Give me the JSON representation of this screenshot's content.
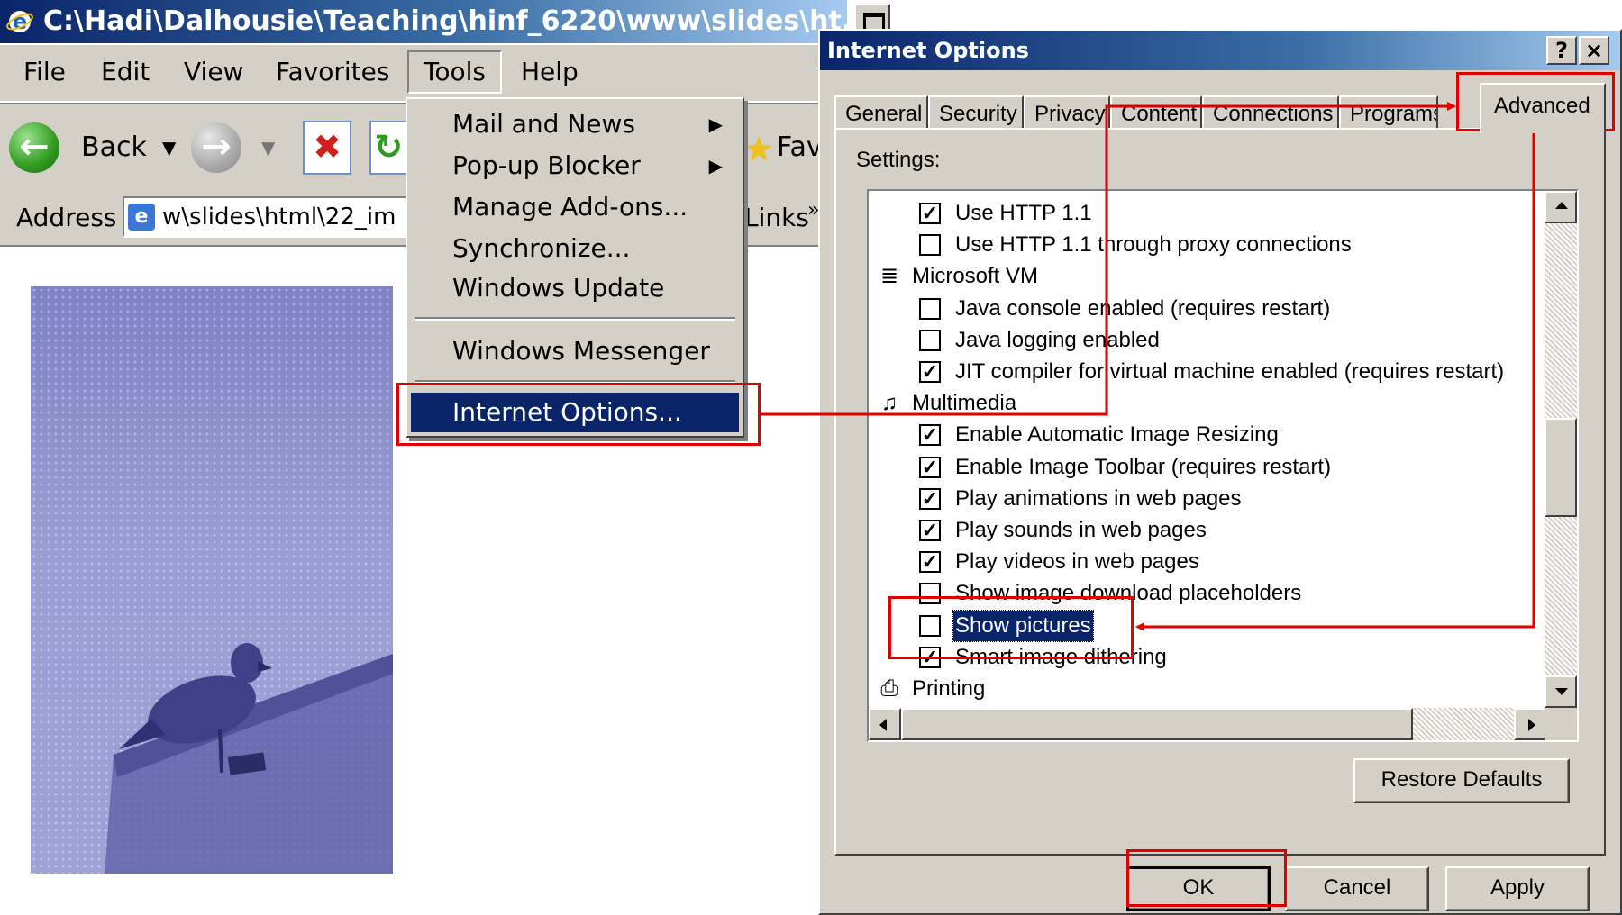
{
  "browser": {
    "title": "C:\\Hadi\\Dalhousie\\Teaching\\hinf_6220\\www\\slides\\ht...",
    "menu": [
      {
        "label": "File"
      },
      {
        "label": "Edit"
      },
      {
        "label": "View"
      },
      {
        "label": "Favorites"
      },
      {
        "label": "Tools"
      },
      {
        "label": "Help"
      }
    ],
    "toolbar": {
      "back_label": "Back",
      "favorites_label": "Fav"
    },
    "address": {
      "label": "Address",
      "value": "w\\slides\\html\\22_im",
      "links_label": "Links"
    }
  },
  "tools_menu": {
    "items": [
      {
        "label": "Mail and News",
        "submenu": true
      },
      {
        "label": "Pop-up Blocker",
        "submenu": true
      },
      {
        "label": "Manage Add-ons...",
        "submenu": false
      },
      {
        "label": "Synchronize...",
        "submenu": false
      },
      {
        "label": "Windows Update",
        "submenu": false
      },
      {
        "label": "Windows Messenger",
        "submenu": false
      },
      {
        "label": "Internet Options...",
        "submenu": false,
        "selected": true
      }
    ]
  },
  "dialog": {
    "title": "Internet Options",
    "help_label": "?",
    "close_label": "×",
    "tabs": [
      {
        "label": "General"
      },
      {
        "label": "Security"
      },
      {
        "label": "Privacy"
      },
      {
        "label": "Content"
      },
      {
        "label": "Connections"
      },
      {
        "label": "Programs"
      },
      {
        "label": "Advanced",
        "active": true
      }
    ],
    "settings_label": "Settings:",
    "settings": [
      {
        "kind": "option",
        "label": "Use HTTP 1.1",
        "checked": true
      },
      {
        "kind": "option",
        "label": "Use HTTP 1.1 through proxy connections",
        "checked": false
      },
      {
        "kind": "category",
        "label": "Microsoft VM",
        "icon": "document-icon"
      },
      {
        "kind": "option",
        "label": "Java console enabled (requires restart)",
        "checked": false
      },
      {
        "kind": "option",
        "label": "Java logging enabled",
        "checked": false
      },
      {
        "kind": "option",
        "label": "JIT compiler for virtual machine enabled (requires restart)",
        "checked": true
      },
      {
        "kind": "category",
        "label": "Multimedia",
        "icon": "multimedia-icon"
      },
      {
        "kind": "option",
        "label": "Enable Automatic Image Resizing",
        "checked": true
      },
      {
        "kind": "option",
        "label": "Enable Image Toolbar (requires restart)",
        "checked": true
      },
      {
        "kind": "option",
        "label": "Play animations in web pages",
        "checked": true
      },
      {
        "kind": "option",
        "label": "Play sounds in web pages",
        "checked": true
      },
      {
        "kind": "option",
        "label": "Play videos in web pages",
        "checked": true
      },
      {
        "kind": "option",
        "label": "Show image download placeholders",
        "checked": false
      },
      {
        "kind": "option",
        "label": "Show pictures",
        "checked": false,
        "selected": true
      },
      {
        "kind": "option",
        "label": "Smart image dithering",
        "checked": true
      },
      {
        "kind": "category",
        "label": "Printing",
        "icon": "printer-icon"
      }
    ],
    "restore_defaults_label": "Restore Defaults",
    "ok_label": "OK",
    "cancel_label": "Cancel",
    "apply_label": "Apply"
  },
  "colors": {
    "highlight": "#e00000",
    "title_bar": "#0a246a",
    "face": "#d4d0c8"
  }
}
